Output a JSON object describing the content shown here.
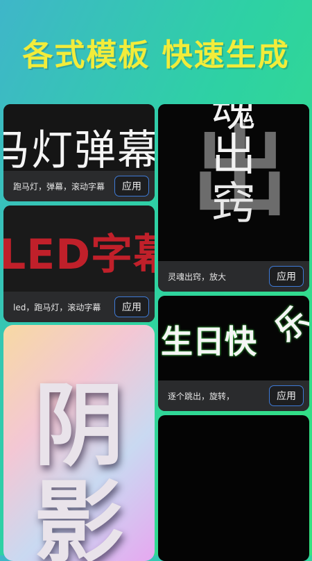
{
  "headline": "各式模板 快速生成",
  "cards": [
    {
      "preview_text": "马灯弹幕",
      "description": "跑马灯，弹幕，滚动字幕",
      "apply_label": "应用"
    },
    {
      "preview_text": "LED字幕",
      "description": "led，跑马灯，滚动字幕",
      "apply_label": "应用"
    },
    {
      "preview_chars": [
        "阴",
        "影"
      ]
    },
    {
      "preview_chars": [
        "魂",
        "出",
        "窍"
      ],
      "description": "灵魂出窍，放大",
      "apply_label": "应用"
    },
    {
      "preview_text": "生日快",
      "preview_tilted": "乐",
      "description": "逐个跳出，旋转，",
      "apply_label": "应用"
    },
    {}
  ],
  "colors": {
    "headline": "#f2ec3a",
    "button_border": "#3f7bd8",
    "led_red": "#c0202a",
    "glow_green": "#48d84e"
  }
}
